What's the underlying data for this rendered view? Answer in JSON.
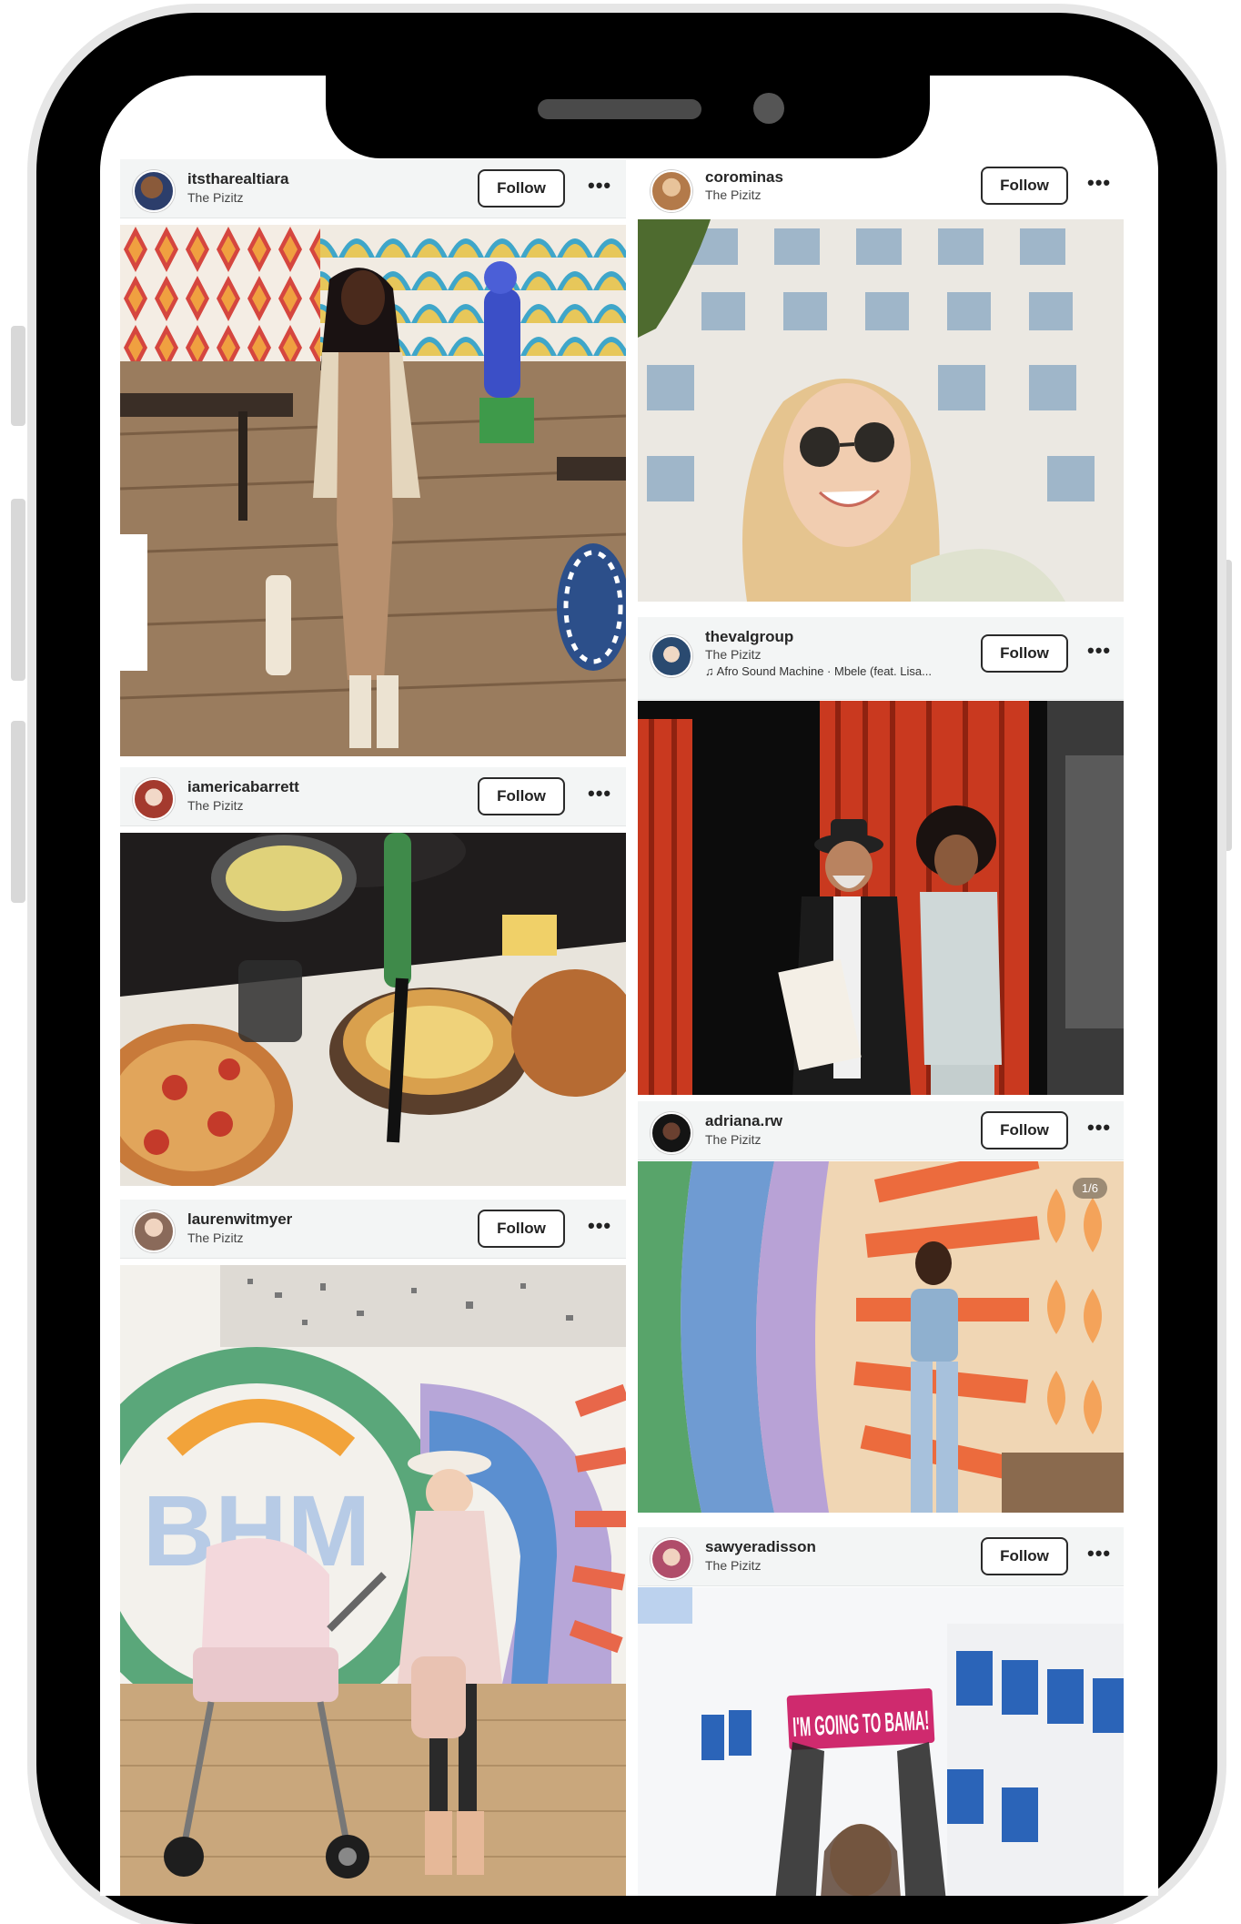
{
  "posts": [
    {
      "username": "itstharealtiara",
      "location": "The Pizitz",
      "follow": "Follow",
      "more": "•••"
    },
    {
      "username": "corominas",
      "location": "The Pizitz",
      "follow": "Follow",
      "more": "•••"
    },
    {
      "username": "thevalgroup",
      "location": "The Pizitz",
      "music": "Afro Sound Machine · Mbele (feat. Lisa...",
      "follow": "Follow",
      "more": "•••"
    },
    {
      "username": "iamericabarrett",
      "location": "The Pizitz",
      "follow": "Follow",
      "more": "•••"
    },
    {
      "username": "adriana.rw",
      "location": "The Pizitz",
      "follow": "Follow",
      "more": "•••",
      "counter": "1/6"
    },
    {
      "username": "laurenwitmyer",
      "location": "The Pizitz",
      "follow": "Follow",
      "more": "•••"
    },
    {
      "username": "sawyeradisson",
      "location": "The Pizitz",
      "follow": "Follow",
      "more": "•••"
    }
  ],
  "icons": {
    "music": "music-note-icon",
    "more": "more-options-icon"
  },
  "mural_text": {
    "bhm": "BHM",
    "sign": "I'M GOING TO BAMA!"
  },
  "colors": {
    "frame": "#000000",
    "header_bg": "#f3f5f5",
    "text": "#262626"
  }
}
